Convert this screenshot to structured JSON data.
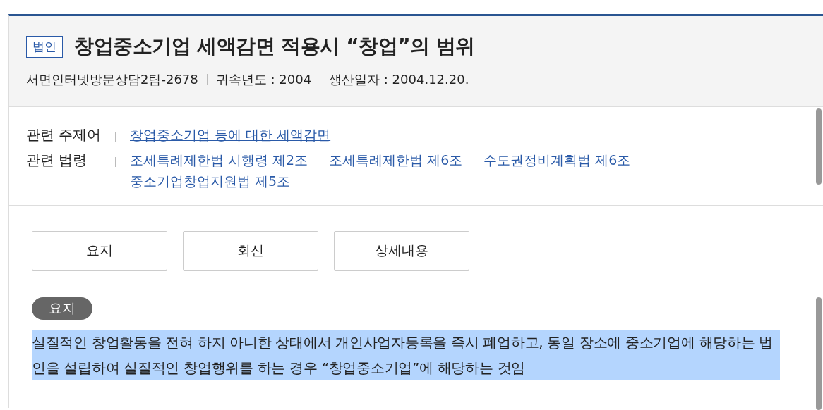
{
  "header": {
    "category_badge": "법인",
    "title": "창업중소기업 세액감면 적용시 “창업”의 범위",
    "meta": [
      "서면인터넷방문상담2팀-2678",
      "귀속년도 : 2004",
      "생산일자 : 2004.12.20."
    ]
  },
  "related": [
    {
      "label": "관련 주제어",
      "links": [
        "창업중소기업 등에 대한 세액감면"
      ]
    },
    {
      "label": "관련 법령",
      "links": [
        "조세특례제한법 시행령 제2조",
        "조세특례제한법 제6조",
        "수도권정비계획법 제6조",
        "중소기업창업지원법 제5조"
      ]
    }
  ],
  "section_buttons": [
    "요지",
    "회신",
    "상세내용"
  ],
  "summary": {
    "badge": "요지",
    "text": "실질적인 창업활동을 전혀 하지 아니한 상태에서 개인사업자등록을 즉시 폐업하고, 동일 장소에 중소기업에 해당하는 법인을 설립하여 실질적인 창업행위를 하는 경우 “창업중소기업”에 해당하는 것임",
    "selected": true
  }
}
